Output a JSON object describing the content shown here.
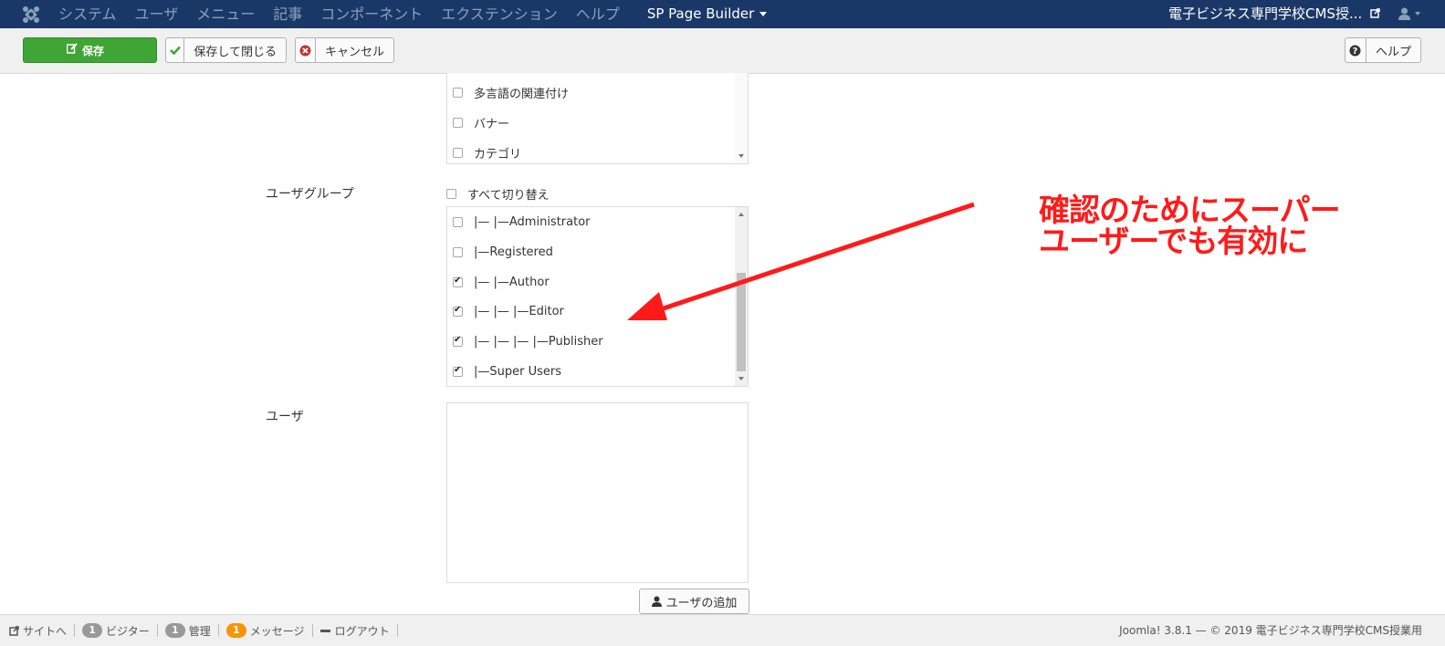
{
  "navbar": {
    "menu": [
      "システム",
      "ユーザ",
      "メニュー",
      "記事",
      "コンポーネント",
      "エクステンション",
      "ヘルプ"
    ],
    "builder": "SP Page Builder",
    "site_title": "電子ビジネス専門学校CMS授..."
  },
  "toolbar": {
    "save": "保存",
    "save_close": "保存して閉じる",
    "cancel": "キャンセル",
    "help": "ヘルプ"
  },
  "content_list": {
    "items": [
      "多言語の関連付け",
      "バナー",
      "カテゴリ"
    ]
  },
  "user_groups": {
    "label": "ユーザグループ",
    "toggle_all": "すべて切り替え",
    "items": [
      {
        "label": "|—  |—Administrator",
        "checked": false
      },
      {
        "label": "|—Registered",
        "checked": false
      },
      {
        "label": "|—  |—Author",
        "checked": true
      },
      {
        "label": "|—  |—  |—Editor",
        "checked": true
      },
      {
        "label": "|—  |—  |—  |—Publisher",
        "checked": true
      },
      {
        "label": "|—Super Users",
        "checked": true
      }
    ]
  },
  "users": {
    "label": "ユーザ",
    "add_button": "ユーザの追加"
  },
  "annotation": {
    "line1": "確認のためにスーパー",
    "line2": "ユーザーでも有効に"
  },
  "statusbar": {
    "site": "サイトへ",
    "visitors_count": "1",
    "visitors": "ビジター",
    "admin_count": "1",
    "admin": "管理",
    "messages_count": "1",
    "messages": "メッセージ",
    "logout": "ログアウト",
    "footer": "Joomla! 3.8.1  —  © 2019 電子ビジネス専門学校CMS授業用"
  },
  "colors": {
    "navbar": "#1a3867",
    "save_button": "#3fa535",
    "annotation": "#ff1a1a",
    "badge_orange": "#f89406"
  }
}
